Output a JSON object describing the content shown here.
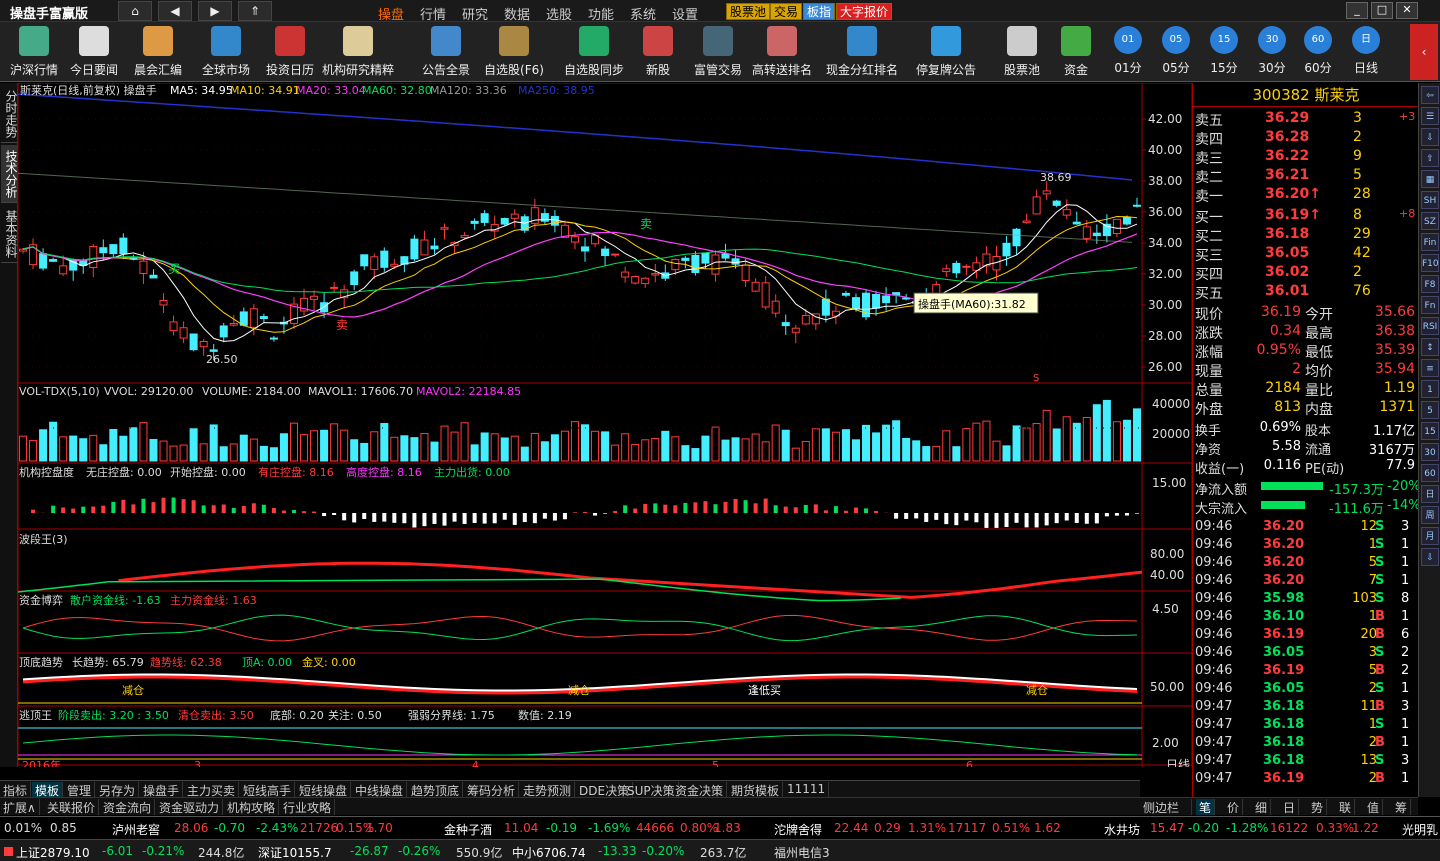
{
  "app": {
    "title": "操盘手富赢版"
  },
  "nav": {
    "home": "⌂",
    "back": "◀",
    "fwd": "▶",
    "up": "⇑"
  },
  "menu": [
    "操盘",
    "行情",
    "研究",
    "数据",
    "选股",
    "功能",
    "系统",
    "设置"
  ],
  "tags": [
    "股票池",
    "交易",
    "板指",
    "大字报价"
  ],
  "toolbar": [
    "沪深行情",
    "今日要闻",
    "晨会汇编",
    "全球市场",
    "投资日历",
    "机构研究精粹",
    "公告全景",
    "自选股(F6)",
    "自选股同步",
    "新股",
    "富管交易",
    "高转送排名",
    "现金分红排名",
    "停复牌公告",
    "股票池",
    "资金",
    "01分",
    "05分",
    "15分",
    "30分",
    "60分",
    "日线"
  ],
  "side_tabs": [
    "分时走势",
    "技术分析",
    "基本资料"
  ],
  "main": {
    "title": "斯莱克(日线,前复权) 操盘手",
    "ma5": "MA5: 34.95",
    "ma10": "MA10: 34.91",
    "ma20": "MA20: 33.04",
    "ma60": "MA60: 32.80",
    "ma120": "MA120: 33.36",
    "ma250": "MA250: 38.95",
    "yticks": [
      "42.00",
      "40.00",
      "38.00",
      "36.00",
      "34.00",
      "32.00",
      "30.00",
      "28.00",
      "26.00"
    ],
    "high_label": "38.69",
    "low_label": "26.50",
    "tooltip": "操盘手(MA60):31.82",
    "buy": "买",
    "sell": "卖",
    "sell2": "卖",
    "s_mark": "S"
  },
  "vol": {
    "title": "VOL-TDX(5,10)",
    "vvol": "VVOL: 29120.00",
    "volume": "VOLUME: 2184.00",
    "mavol1": "MAVOL1: 17606.70",
    "mavol2": "MAVOL2: 22184.85",
    "yticks": [
      "40000",
      "20000"
    ]
  },
  "jg": {
    "title": "机构控盘度",
    "a": "无庄控盘: 0.00",
    "b": "开始控盘: 0.00",
    "c": "有庄控盘: 8.16",
    "d": "高度控盘: 8.16",
    "e": "主力出货: 0.00",
    "ytick": "15.00"
  },
  "bd": {
    "title": "波段王(3)",
    "yticks": [
      "80.00",
      "40.00"
    ]
  },
  "zj": {
    "title": "资金博弈",
    "a": "散户资金线: -1.63",
    "b": "主力资金线: 1.63",
    "ytick": "4.50"
  },
  "dd": {
    "title": "顶底趋势",
    "a": "长趋势: 65.79",
    "b": "趋势线: 62.38",
    "c": "顶A: 0.00",
    "d": "金叉: 0.00",
    "ytick": "50.00",
    "lab1": "减仓",
    "lab2": "减仓",
    "lab3": "逢低买",
    "lab4": "减仓"
  },
  "td": {
    "title": "逃顶王",
    "a": "阶段卖出: 3.20 : 3.50",
    "b": "清仓卖出: 3.50",
    "c": "底部: 0.20",
    "d": "关注: 0.50",
    "e": "强弱分界线: 1.75",
    "f": "数值: 2.19",
    "ytick": "2.00"
  },
  "xaxis": {
    "labels": [
      "2016年",
      "3",
      "4",
      "5",
      "6"
    ],
    "period": "日线"
  },
  "bottom_tabs": [
    "指标",
    "模板",
    "管理",
    "另存为",
    "操盘手",
    "主力买卖",
    "短线高手",
    "短线操盘",
    "中线操盘",
    "趋势顶底",
    "筹码分析",
    "走势预测",
    "DDE决策",
    "SUP决策",
    "资金决策",
    "期货模板",
    "11111"
  ],
  "bottom_tabs2": [
    "扩展∧",
    "关联报价",
    "资金流向",
    "资金驱动力",
    "机构攻略",
    "行业攻略"
  ],
  "side_small": "侧边栏<",
  "right_tabs": [
    "笔",
    "价",
    "细",
    "日",
    "势",
    "联",
    "值",
    "筹"
  ],
  "stock": {
    "code": "300382",
    "name": "斯莱克"
  },
  "orderbook": {
    "sell": [
      [
        "卖五",
        "36.29",
        "3",
        "+3"
      ],
      [
        "卖四",
        "36.28",
        "2",
        ""
      ],
      [
        "卖三",
        "36.22",
        "9",
        ""
      ],
      [
        "卖二",
        "36.21",
        "5",
        ""
      ],
      [
        "卖一",
        "36.20↑",
        "28",
        ""
      ]
    ],
    "buy": [
      [
        "买一",
        "36.19↑",
        "8",
        "+8"
      ],
      [
        "买二",
        "36.18",
        "29",
        ""
      ],
      [
        "买三",
        "36.05",
        "42",
        ""
      ],
      [
        "买四",
        "36.02",
        "2",
        ""
      ],
      [
        "买五",
        "36.01",
        "76",
        ""
      ]
    ]
  },
  "quote": [
    [
      "现价",
      "36.19",
      "今开",
      "35.66"
    ],
    [
      "涨跌",
      "0.34",
      "最高",
      "36.38"
    ],
    [
      "涨幅",
      "0.95%",
      "最低",
      "35.39"
    ],
    [
      "现量",
      "2",
      "均价",
      "35.94"
    ],
    [
      "总量",
      "2184",
      "量比",
      "1.19"
    ],
    [
      "外盘",
      "813",
      "内盘",
      "1371"
    ]
  ],
  "quote2": [
    [
      "换手",
      "0.69%",
      "股本",
      "1.17亿"
    ],
    [
      "净资",
      "5.58",
      "流通",
      "3167万"
    ],
    [
      "收益(一)",
      "0.116",
      "PE(动)",
      "77.9"
    ]
  ],
  "flow": [
    [
      "净流入额",
      "-157.3万",
      "-20%"
    ],
    [
      "大宗流入",
      "-111.6万",
      "-14%"
    ]
  ],
  "ticks": [
    [
      "09:46",
      "36.20",
      "12",
      "S",
      "3"
    ],
    [
      "09:46",
      "36.20",
      "1",
      "S",
      "1"
    ],
    [
      "09:46",
      "36.20",
      "5",
      "S",
      "1"
    ],
    [
      "09:46",
      "36.20",
      "7",
      "S",
      "1"
    ],
    [
      "09:46",
      "35.98",
      "103",
      "S",
      "8"
    ],
    [
      "09:46",
      "36.10",
      "1",
      "B",
      "1"
    ],
    [
      "09:46",
      "36.19",
      "20",
      "B",
      "6"
    ],
    [
      "09:46",
      "36.05",
      "3",
      "S",
      "2"
    ],
    [
      "09:46",
      "36.19",
      "5",
      "B",
      "2"
    ],
    [
      "09:46",
      "36.05",
      "2",
      "S",
      "1"
    ],
    [
      "09:47",
      "36.18",
      "11",
      "B",
      "3"
    ],
    [
      "09:47",
      "36.18",
      "1",
      "S",
      "1"
    ],
    [
      "09:47",
      "36.18",
      "2",
      "B",
      "1"
    ],
    [
      "09:47",
      "36.18",
      "13",
      "S",
      "3"
    ],
    [
      "09:47",
      "36.19",
      "2",
      "B",
      "1"
    ]
  ],
  "ticker": [
    [
      "0.01%",
      "0.85",
      "泸州老窖",
      "28.06",
      "-0.70",
      "-2.43%",
      "21726",
      "0.15%",
      "1.70"
    ],
    [
      "金种子酒",
      "11.04",
      "-0.19",
      "-1.69%",
      "44666",
      "0.80%",
      "1.83"
    ],
    [
      "沱牌舍得",
      "22.44",
      "0.29",
      "1.31%",
      "17117",
      "0.51%",
      "1.62"
    ],
    [
      "水井坊",
      "15.47",
      "-0.20",
      "-1.28%",
      "16122",
      "0.33%",
      "1.22",
      "光明乳"
    ]
  ],
  "status": {
    "sh": "上证2879.10",
    "sh_chg": "-6.01",
    "sh_pct": "-0.21%",
    "sh_amt": "244.8亿",
    "sz": "深证10155.7",
    "sz_chg": "-26.87",
    "sz_pct": "-0.26%",
    "sz_amt": "550.9亿",
    "zx": "中小6706.74",
    "zx_chg": "-13.33",
    "zx_pct": "-0.20%",
    "zx_amt": "263.7亿",
    "broker": "福州电信3"
  },
  "colors": {
    "up": "#ff3b3b",
    "down": "#4ef",
    "ma5": "#ffffff",
    "ma10": "#ffd200",
    "ma20": "#ff40ff",
    "ma60": "#00e05a",
    "ma120": "#aaa",
    "ma250": "#2233cc"
  }
}
